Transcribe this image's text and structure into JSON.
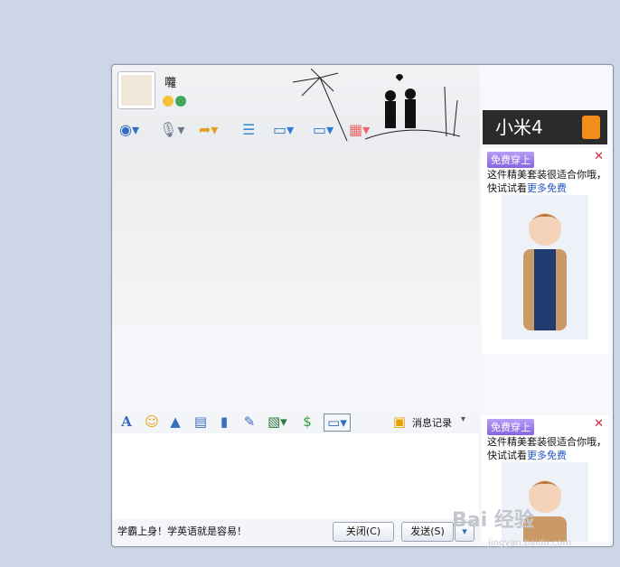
{
  "contact": {
    "name": "囖"
  },
  "window_controls": [
    {
      "name": "pin-icon",
      "glyph": "▣"
    },
    {
      "name": "minimize-icon",
      "glyph": "—"
    },
    {
      "name": "maximize-icon",
      "glyph": "□"
    },
    {
      "name": "close-icon",
      "glyph": "✕"
    }
  ],
  "toolbar_top_icons": [
    "video-call-icon",
    "voice-call-icon",
    "send-file-icon",
    "create-discussion-icon",
    "remote-assist-icon",
    "share-screen-icon",
    "apps-icon"
  ],
  "toolbar_bottom_icons": [
    "font-icon",
    "emoji-icon",
    "wizard-icon",
    "screenshot-icon",
    "voice-message-icon",
    "doodle-icon",
    "image-icon",
    "gift-icon",
    "screen-capture-icon"
  ],
  "history_label": "消息记录",
  "input_text": "学霸上身！学英语就是容易！",
  "buttons": {
    "close": "关闭(C)",
    "send": "发送(S)"
  },
  "sidebar_ad_banner": "小米4",
  "ads": [
    {
      "tag": "免费穿上",
      "text": "这件精美套装很适合你哦，快试试看",
      "more": "更多免费"
    },
    {
      "tag": "免费穿上",
      "text": "这件精美套装很适合你哦，快试试看",
      "more": "更多免费"
    }
  ],
  "watermark": {
    "main": "Bai 经验",
    "sub": "jingyan.baidu.com"
  },
  "colors": {
    "accent": "#8763e0",
    "close_red": "#d3283b",
    "link": "#2056c8"
  }
}
